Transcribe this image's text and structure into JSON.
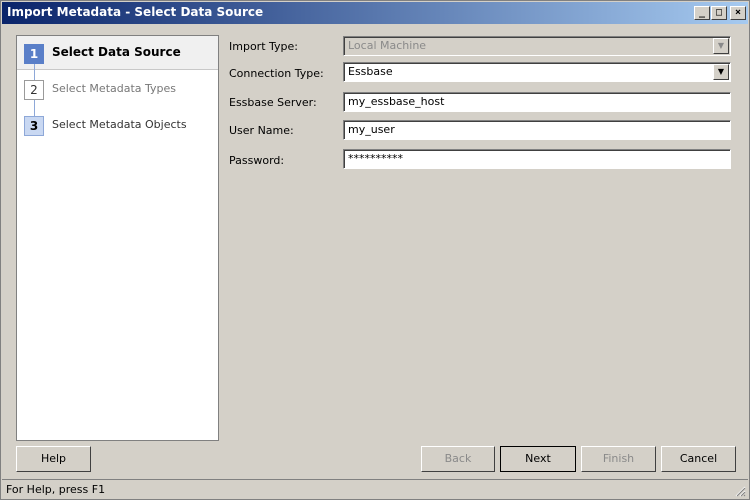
{
  "window": {
    "title": "Import Metadata - Select Data Source",
    "controls": {
      "minimize": "_",
      "maximize": "□",
      "close": "×"
    }
  },
  "steps": [
    {
      "number": "1",
      "label": "Select Data Source",
      "state": "active"
    },
    {
      "number": "2",
      "label": "Select Metadata Types",
      "state": "inactive"
    },
    {
      "number": "3",
      "label": "Select Metadata Objects",
      "state": "selectable"
    }
  ],
  "form": {
    "import_type": {
      "label": "Import Type:",
      "value": "Local Machine",
      "disabled": true
    },
    "connection_type": {
      "label": "Connection Type:",
      "value": "Essbase"
    },
    "essbase_server": {
      "label": "Essbase Server:",
      "value": "my_essbase_host"
    },
    "user_name": {
      "label": "User Name:",
      "value": "my_user"
    },
    "password": {
      "label": "Password:",
      "value": "**********"
    }
  },
  "buttons": {
    "help": "Help",
    "back": "Back",
    "next": "Next",
    "finish": "Finish",
    "cancel": "Cancel"
  },
  "status": {
    "text": "For Help, press F1"
  },
  "icons": {
    "dropdown": "chevron-down-icon",
    "resize_grip": "resize-grip-icon"
  }
}
